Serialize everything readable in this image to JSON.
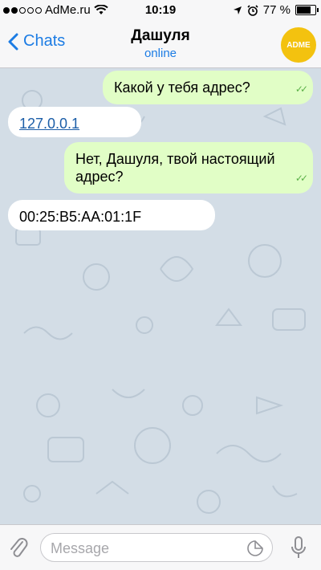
{
  "status_bar": {
    "carrier": "AdMe.ru",
    "time": "10:19",
    "battery_percent": "77 %",
    "battery_level": 0.77
  },
  "header": {
    "back_label": "Chats",
    "contact_name": "Дашуля",
    "contact_status": "online",
    "avatar_text": "ADME"
  },
  "messages": [
    {
      "direction": "outgoing",
      "text": "Какой у тебя адрес?"
    },
    {
      "direction": "incoming",
      "text": "127.0.0.1"
    },
    {
      "direction": "outgoing",
      "text": "Нет, Дашуля, твой настоящий адрес?"
    },
    {
      "direction": "incoming",
      "text": "00:25:B5:AA:01:1F"
    }
  ],
  "composer": {
    "placeholder": "Message"
  },
  "colors": {
    "accent": "#1c7ce4",
    "outgoing_bubble": "#e1fec6",
    "incoming_bubble": "#ffffff",
    "chat_background": "#d3dde6",
    "avatar": "#f3c20f"
  }
}
